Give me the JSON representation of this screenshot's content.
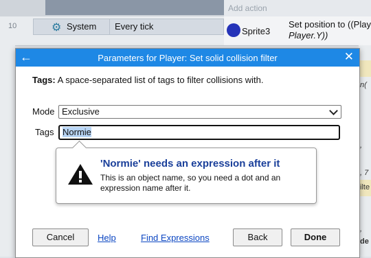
{
  "event_sheet": {
    "add_action": "Add action",
    "row_number": "10",
    "condition_object": "System",
    "condition_text": "Every tick",
    "action_object": "Sprite3",
    "action_text_line1": "Set position to ((Playe",
    "action_text_line2": "Player.Y))",
    "right_fragments": [
      "n(",
      ", ",
      ", 7",
      "ilte",
      ", ",
      "de"
    ]
  },
  "dialog": {
    "title": "Parameters for Player: Set solid collision filter",
    "param_label": "Tags:",
    "param_description": "A space-separated list of tags to filter collisions with.",
    "mode_label": "Mode",
    "mode_value": "Exclusive",
    "tags_label": "Tags",
    "tags_value": "Normie",
    "error_title": "'Normie' needs an expression after it",
    "error_body": "This is an object name, so you need a dot and an expression name after it.",
    "cancel_label": "Cancel",
    "help_label": "Help",
    "find_expressions_label": "Find Expressions",
    "back_label": "Back",
    "done_label": "Done"
  },
  "colors": {
    "titlebar": "#1e88e5",
    "link": "#0b46c2",
    "error_title": "#1a3f9a"
  }
}
